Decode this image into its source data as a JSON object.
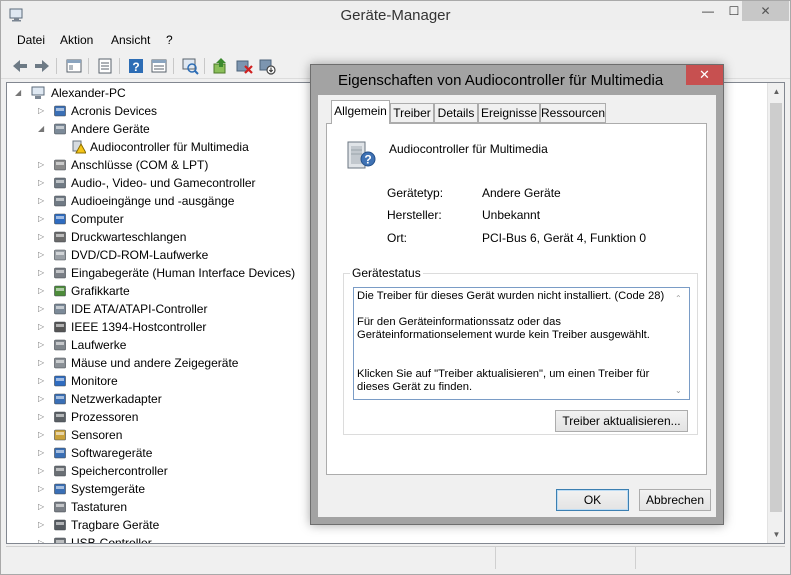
{
  "window": {
    "title": "Geräte-Manager",
    "minimize": "—",
    "maximize": "☐",
    "close": "✕"
  },
  "menu": [
    "Datei",
    "Aktion",
    "Ansicht",
    "?"
  ],
  "toolbar": {
    "icons": [
      "back-icon",
      "forward-icon",
      "show-hide-tree-icon",
      "properties-icon",
      "help-icon",
      "view-icon",
      "scan-hardware-icon",
      "update-driver-icon",
      "uninstall-icon",
      "disable-icon"
    ]
  },
  "tree": {
    "root": "Alexander-PC",
    "nodes": [
      {
        "label": "Acronis Devices",
        "icon": "acronis-icon",
        "expander": "▷",
        "level": 1
      },
      {
        "label": "Andere Geräte",
        "icon": "other-devices-icon",
        "expander": "◢",
        "level": 1
      },
      {
        "label": "Audiocontroller für Multimedia",
        "icon": "warning-device-icon",
        "expander": "",
        "level": 2
      },
      {
        "label": "Anschlüsse (COM & LPT)",
        "icon": "port-icon",
        "expander": "▷",
        "level": 1
      },
      {
        "label": "Audio-, Video- und Gamecontroller",
        "icon": "speaker-icon",
        "expander": "▷",
        "level": 1
      },
      {
        "label": "Audioeingänge und -ausgänge",
        "icon": "speaker-icon",
        "expander": "▷",
        "level": 1
      },
      {
        "label": "Computer",
        "icon": "monitor-icon",
        "expander": "▷",
        "level": 1
      },
      {
        "label": "Druckwarteschlangen",
        "icon": "printer-icon",
        "expander": "▷",
        "level": 1
      },
      {
        "label": "DVD/CD-ROM-Laufwerke",
        "icon": "disc-icon",
        "expander": "▷",
        "level": 1
      },
      {
        "label": "Eingabegeräte (Human Interface Devices)",
        "icon": "hid-icon",
        "expander": "▷",
        "level": 1
      },
      {
        "label": "Grafikkarte",
        "icon": "display-adapter-icon",
        "expander": "▷",
        "level": 1
      },
      {
        "label": "IDE ATA/ATAPI-Controller",
        "icon": "ide-icon",
        "expander": "▷",
        "level": 1
      },
      {
        "label": "IEEE 1394-Hostcontroller",
        "icon": "firewire-icon",
        "expander": "▷",
        "level": 1
      },
      {
        "label": "Laufwerke",
        "icon": "drive-icon",
        "expander": "▷",
        "level": 1
      },
      {
        "label": "Mäuse und andere Zeigegeräte",
        "icon": "mouse-icon",
        "expander": "▷",
        "level": 1
      },
      {
        "label": "Monitore",
        "icon": "monitor-icon",
        "expander": "▷",
        "level": 1
      },
      {
        "label": "Netzwerkadapter",
        "icon": "network-icon",
        "expander": "▷",
        "level": 1
      },
      {
        "label": "Prozessoren",
        "icon": "cpu-icon",
        "expander": "▷",
        "level": 1
      },
      {
        "label": "Sensoren",
        "icon": "sensor-icon",
        "expander": "▷",
        "level": 1
      },
      {
        "label": "Softwaregeräte",
        "icon": "software-device-icon",
        "expander": "▷",
        "level": 1
      },
      {
        "label": "Speichercontroller",
        "icon": "storage-controller-icon",
        "expander": "▷",
        "level": 1
      },
      {
        "label": "Systemgeräte",
        "icon": "system-device-icon",
        "expander": "▷",
        "level": 1
      },
      {
        "label": "Tastaturen",
        "icon": "keyboard-icon",
        "expander": "▷",
        "level": 1
      },
      {
        "label": "Tragbare Geräte",
        "icon": "portable-device-icon",
        "expander": "▷",
        "level": 1
      },
      {
        "label": "USB-Controller",
        "icon": "usb-icon",
        "expander": "▷",
        "level": 1
      }
    ]
  },
  "dialog": {
    "title": "Eigenschaften von Audiocontroller für Multimedia",
    "close": "✕",
    "tabs": [
      "Allgemein",
      "Treiber",
      "Details",
      "Ereignisse",
      "Ressourcen"
    ],
    "active_tab": "Allgemein",
    "device_name": "Audiocontroller für Multimedia",
    "props": [
      {
        "label": "Gerätetyp:",
        "value": "Andere Geräte"
      },
      {
        "label": "Hersteller:",
        "value": "Unbekannt"
      },
      {
        "label": "Ort:",
        "value": "PCI-Bus 6, Gerät 4, Funktion 0"
      }
    ],
    "status_legend": "Gerätestatus",
    "status_lines": [
      "Die Treiber für dieses Gerät wurden nicht installiert. (Code 28)",
      "Für den Geräteinformationssatz oder das Geräteinformationselement wurde kein Treiber ausgewählt.",
      "Klicken Sie auf \"Treiber aktualisieren\", um einen Treiber für dieses Gerät zu finden."
    ],
    "update_button": "Treiber aktualisieren...",
    "ok_button": "OK",
    "cancel_button": "Abbrechen"
  },
  "colors": {
    "dialog_frame": "#a3a3a3",
    "close_button": "#c75050",
    "warning": "#f5c518"
  }
}
